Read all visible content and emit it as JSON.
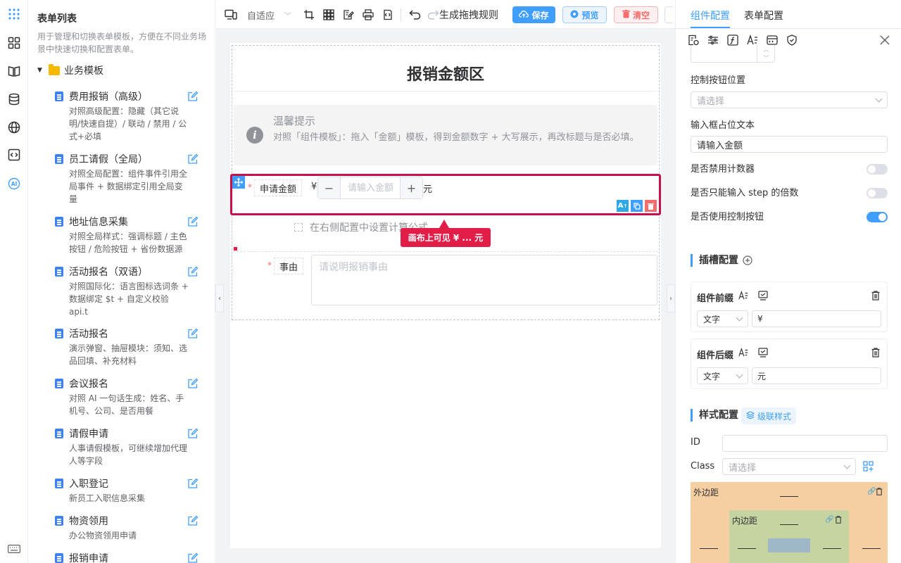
{
  "rail": {
    "icons": [
      "grid-apps-icon",
      "layout-icon",
      "book-icon",
      "database-icon",
      "globe-icon",
      "code-icon",
      "ai-icon",
      "keyboard-icon"
    ]
  },
  "list": {
    "title": "表单列表",
    "description": "用于管理和切换表单模板，方便在不同业务场景中快速切换和配置表单。",
    "folder": "业务模板",
    "items": [
      {
        "name": "费用报销（高级）",
        "sub": "对照高级配置：隐藏（其它说明/快速自提）/ 联动 / 禁用 / 公式+必填"
      },
      {
        "name": "员工请假（全局）",
        "sub": "对照全局配置：组件事件引用全局事件 + 数据绑定引用全局变量"
      },
      {
        "name": "地址信息采集",
        "sub": "对照全局样式：强调标题 / 主色按钮 / 危险按钮 + 省份数据源"
      },
      {
        "name": "活动报名（双语）",
        "sub": "对照国际化：语言图标选词条 + 数据绑定 $t + 自定义校验 api.t"
      },
      {
        "name": "活动报名",
        "sub": "演示弹窗、抽屉模块：须知、选品回填、补充材料"
      },
      {
        "name": "会议报名",
        "sub": "对照 AI 一句话生成：姓名、手机号、公司、是否用餐"
      },
      {
        "name": "请假申请",
        "sub": "人事请假模板，可继续增加代理人等字段"
      },
      {
        "name": "入职登记",
        "sub": "新员工入职信息采集"
      },
      {
        "name": "物资领用",
        "sub": "办公物资领用申请"
      },
      {
        "name": "报销申请",
        "sub": ""
      }
    ]
  },
  "toolbar": {
    "mode": "自适应",
    "generate_rule": "生成拖拽规则",
    "save": "保存",
    "preview": "预览",
    "clear": "清空"
  },
  "canvas": {
    "title": "报销金额区",
    "alert_title": "温馨提示",
    "alert_desc": "对照「组件模板」：拖入「金额」模板，得到金额数字 + 大写展示，再改标题与是否必填。",
    "amount_label": "申请金额",
    "amount_prefix": "¥",
    "amount_placeholder": "请输入金额",
    "amount_suffix": "元",
    "minus": "−",
    "plus": "+",
    "formula_hint": "在右侧配置中设置计算公式",
    "callout": "画布上可见 ¥ ... 元",
    "reason_label": "事由",
    "reason_placeholder": "请说明报销事由",
    "required_mark": "*",
    "actions": [
      "AI",
      "复制",
      "删除"
    ]
  },
  "config": {
    "tabs": [
      "组件配置",
      "表单配置"
    ],
    "control_position_label": "控制按钮位置",
    "control_position_placeholder": "请选择",
    "placeholder_label": "输入框占位文本",
    "placeholder_value": "请输入金额",
    "disable_counter_label": "是否禁用计数器",
    "step_multiple_label": "是否只能输入 step 的倍数",
    "use_controls_label": "是否使用控制按钮",
    "switches": {
      "disable_counter": false,
      "step_multiple": false,
      "use_controls": true
    },
    "slot_title": "插槽配置",
    "prefix_title": "组件前缀",
    "prefix_type": "文字",
    "prefix_value": "¥",
    "suffix_title": "组件后缀",
    "suffix_type": "文字",
    "suffix_value": "元",
    "style_title": "样式配置",
    "cascade": "级联样式",
    "id_label": "ID",
    "class_label": "Class",
    "class_placeholder": "请选择",
    "margin_label": "外边距",
    "padding_label": "内边距"
  },
  "colors": {
    "accent": "#409eff",
    "danger": "#f56c6c",
    "highlight": "#c8104b",
    "callout": "#e11d48"
  }
}
